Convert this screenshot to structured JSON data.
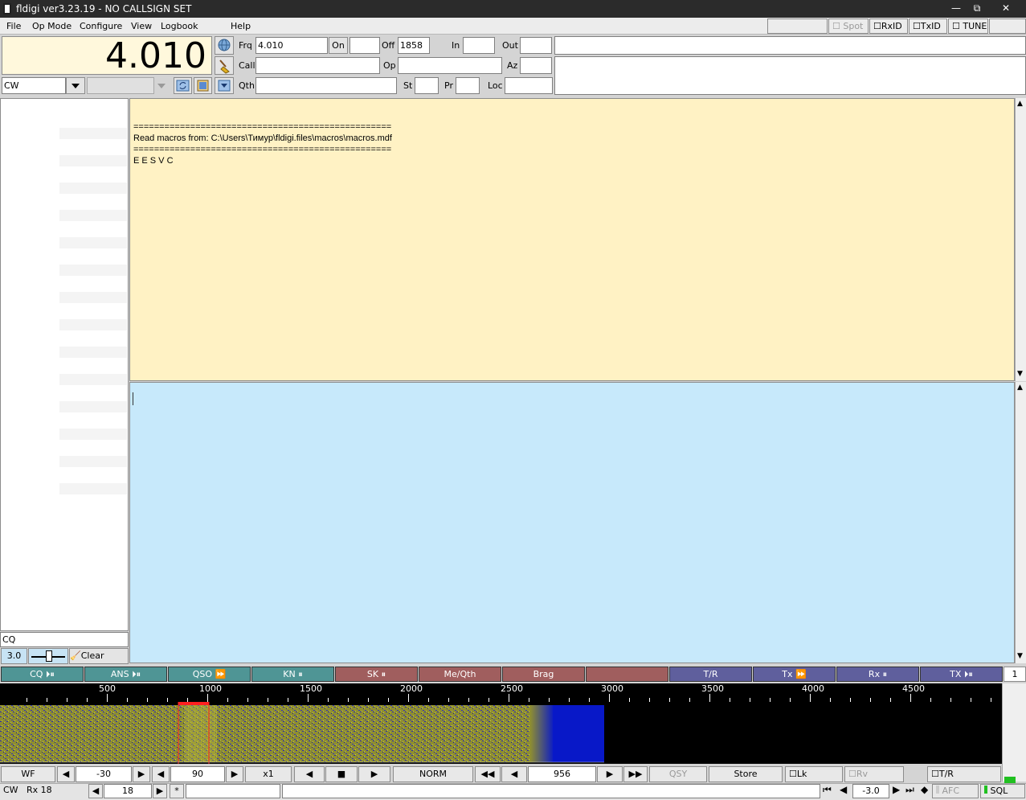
{
  "window": {
    "title": "fldigi ver3.23.19 - NO CALLSIGN SET",
    "min": "—",
    "max": "⧉",
    "close": "✕"
  },
  "menu": [
    "File",
    "Op Mode",
    "Configure",
    "View",
    "Logbook",
    "Help"
  ],
  "toolbar_toggles": {
    "spot": "Spot",
    "rxid": "RxID",
    "txid": "TxID",
    "tune": "TUNE"
  },
  "freq_display": "4.010",
  "log": {
    "frq_label": "Frq",
    "frq": "4.010",
    "on_label": "On",
    "on": "",
    "off_label": "Off",
    "off": "1858",
    "in_label": "In",
    "in": "",
    "out_label": "Out",
    "out": "",
    "call_label": "Call",
    "call": "",
    "op_label": "Op",
    "op": "",
    "az_label": "Az",
    "az": "",
    "qth_label": "Qth",
    "qth": "",
    "st_label": "St",
    "st": "",
    "pr_label": "Pr",
    "pr": "",
    "loc_label": "Loc",
    "loc": ""
  },
  "mode": {
    "value": "CW",
    "second": ""
  },
  "rx_text": {
    "line1": "==================================================",
    "line2": "Read macros from: C:\\Users\\Тимур\\fldigi.files\\macros\\macros.mdf",
    "line3": "==================================================",
    "line4": "E E S V C"
  },
  "left_panel": {
    "cq": "CQ",
    "speed": "3.0",
    "clear": "Clear"
  },
  "macros": [
    {
      "label": "CQ ⏵⏸",
      "color": "teal"
    },
    {
      "label": "ANS ⏵⏸",
      "color": "teal"
    },
    {
      "label": "QSO ⏩",
      "color": "teal"
    },
    {
      "label": "KN ⏸",
      "color": "teal"
    },
    {
      "label": "SK ⏸",
      "color": "red"
    },
    {
      "label": "Me/Qth",
      "color": "red"
    },
    {
      "label": "Brag",
      "color": "red"
    },
    {
      "label": "",
      "color": "red"
    },
    {
      "label": "T/R",
      "color": "blue"
    },
    {
      "label": "Tx ⏩",
      "color": "blue"
    },
    {
      "label": "Rx ⏸",
      "color": "blue"
    },
    {
      "label": "TX ⏵⏸",
      "color": "blue"
    }
  ],
  "macro_page": "1",
  "scale": [
    "500",
    "1000",
    "1500",
    "2000",
    "2500",
    "3000",
    "3500",
    "4000",
    "4500"
  ],
  "wf_controls": {
    "wf": "WF",
    "level": "-30",
    "range": "90",
    "zoom": "x1",
    "norm": "NORM",
    "cursor": "956",
    "qsy": "QSY",
    "store": "Store",
    "lk": "Lk",
    "rv": "Rv",
    "tr": "T/R"
  },
  "status": {
    "mode": "CW",
    "rx": "Rx 18",
    "wpm": "18",
    "star": "*",
    "s2n": "-3.0",
    "afc": "AFC",
    "sql": "SQL"
  }
}
